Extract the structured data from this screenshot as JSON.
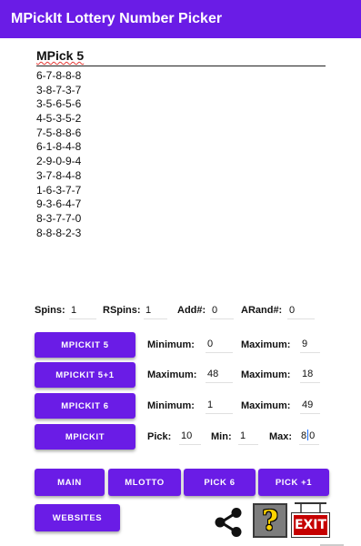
{
  "app": {
    "title": "MPickIt Lottery Number Picker"
  },
  "results": {
    "title": "MPick 5",
    "lines": [
      "6-7-8-8-8",
      "3-8-7-3-7",
      "3-5-6-5-6",
      "4-5-3-5-2",
      "7-5-8-8-6",
      "6-1-8-4-8",
      "2-9-0-9-4",
      "3-7-8-4-8",
      "1-6-3-7-7",
      "9-3-6-4-7",
      "8-3-7-7-0",
      "8-8-8-2-3"
    ]
  },
  "stats": {
    "spins_label": "Spins:",
    "spins_value": "1",
    "rspins_label": "RSpins:",
    "rspins_value": "1",
    "add_label": "Add#:",
    "add_value": "0",
    "arand_label": "ARand#:",
    "arand_value": "0"
  },
  "rows": {
    "mpickit5": {
      "button": "MPICKIT 5",
      "min_label": "Minimum:",
      "min_value": "0",
      "max_label": "Maximum:",
      "max_value": "9"
    },
    "mpickit5plus1": {
      "button": "MPICKIT 5+1",
      "max1_label": "Maximum:",
      "max1_value": "48",
      "max2_label": "Maximum:",
      "max2_value": "18"
    },
    "mpickit6": {
      "button": "MPICKIT 6",
      "min_label": "Minimum:",
      "min_value": "1",
      "max_label": "Maximum:",
      "max_value": "49"
    },
    "mpickit": {
      "button": "MPICKIT",
      "pick_label": "Pick:",
      "pick_value": "10",
      "min_label": "Min:",
      "min_value": "1",
      "max_label": "Max:",
      "max_value_a": "8",
      "max_value_b": "0"
    }
  },
  "nav": {
    "main": "MAIN",
    "mlotto": "MLOTTO",
    "pick6": "PICK 6",
    "pickplus1": "PICK +1",
    "websites": "WEBSITES"
  },
  "icons": {
    "share": "share-icon",
    "help": "help-icon",
    "exit": "exit-icon",
    "exit_text": "EXIT"
  },
  "colors": {
    "accent": "#6a1ce6",
    "exit_red": "#c60000",
    "help_yellow": "#ffd400"
  }
}
